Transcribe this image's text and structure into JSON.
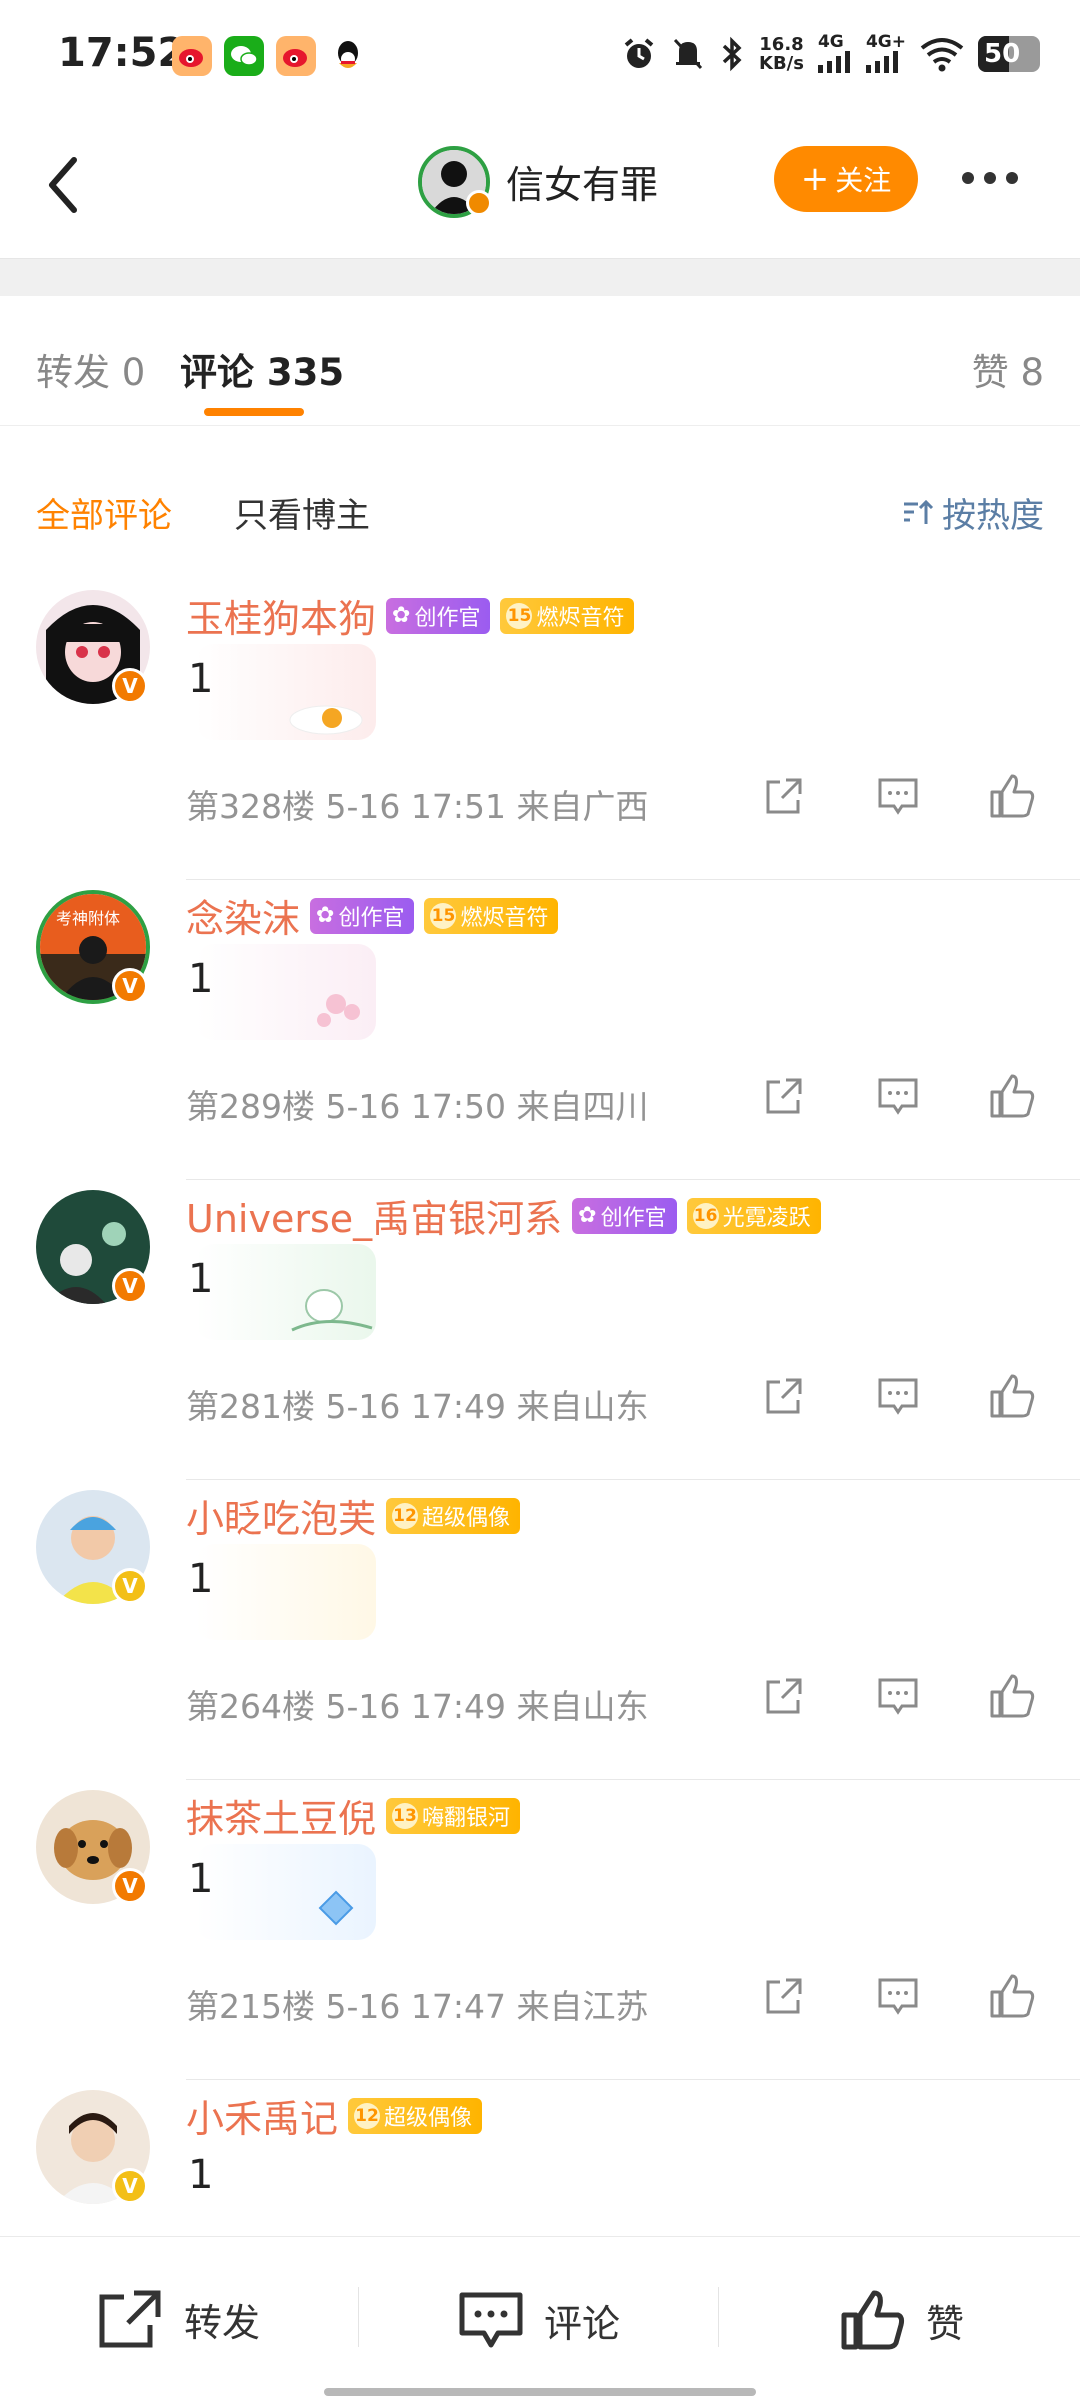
{
  "status_bar": {
    "time": "17:52",
    "speed_value": "16.8",
    "speed_unit": "KB/s",
    "net1": "4G",
    "net2": "4G+",
    "battery": "50"
  },
  "header": {
    "author_name": "信女有罪",
    "follow_label": "关注"
  },
  "tabs": {
    "repost": "转发 0",
    "comments": "评论 335",
    "likes": "赞 8"
  },
  "filters": {
    "all": "全部评论",
    "owner_only": "只看博主",
    "sort": "按热度"
  },
  "comments": [
    {
      "name": "玉桂狗本狗",
      "badges": [
        {
          "type": "creator",
          "label": "创作官"
        },
        {
          "type": "level",
          "num": "15",
          "label": "燃烬音符"
        }
      ],
      "text": "1",
      "floor": "第328楼",
      "time": "5-16 17:51",
      "location": "来自广西"
    },
    {
      "name": "念染沫",
      "badges": [
        {
          "type": "creator",
          "label": "创作官"
        },
        {
          "type": "level",
          "num": "15",
          "label": "燃烬音符"
        }
      ],
      "text": "1",
      "floor": "第289楼",
      "time": "5-16 17:50",
      "location": "来自四川"
    },
    {
      "name": "Universe_禹宙银河系",
      "badges": [
        {
          "type": "creator",
          "label": "创作官"
        },
        {
          "type": "level",
          "num": "16",
          "label": "光霓凌跃"
        }
      ],
      "text": "1",
      "floor": "第281楼",
      "time": "5-16 17:49",
      "location": "来自山东"
    },
    {
      "name": "小眨吃泡芙",
      "badges": [
        {
          "type": "level",
          "num": "12",
          "label": "超级偶像"
        }
      ],
      "text": "1",
      "floor": "第264楼",
      "time": "5-16 17:49",
      "location": "来自山东"
    },
    {
      "name": "抹茶土豆倪",
      "badges": [
        {
          "type": "level",
          "num": "13",
          "label": "嗨翻银河"
        }
      ],
      "text": "1",
      "floor": "第215楼",
      "time": "5-16 17:47",
      "location": "来自江苏"
    },
    {
      "name": "小禾禹记",
      "badges": [
        {
          "type": "level",
          "num": "12",
          "label": "超级偶像"
        }
      ],
      "text": "1",
      "floor": "",
      "time": "",
      "location": ""
    }
  ],
  "bottom_bar": {
    "repost": "转发",
    "comment": "评论",
    "like": "赞"
  },
  "colors": {
    "accent": "#ff8200",
    "username": "#eb7350",
    "sort_link": "#5b7ea5"
  }
}
